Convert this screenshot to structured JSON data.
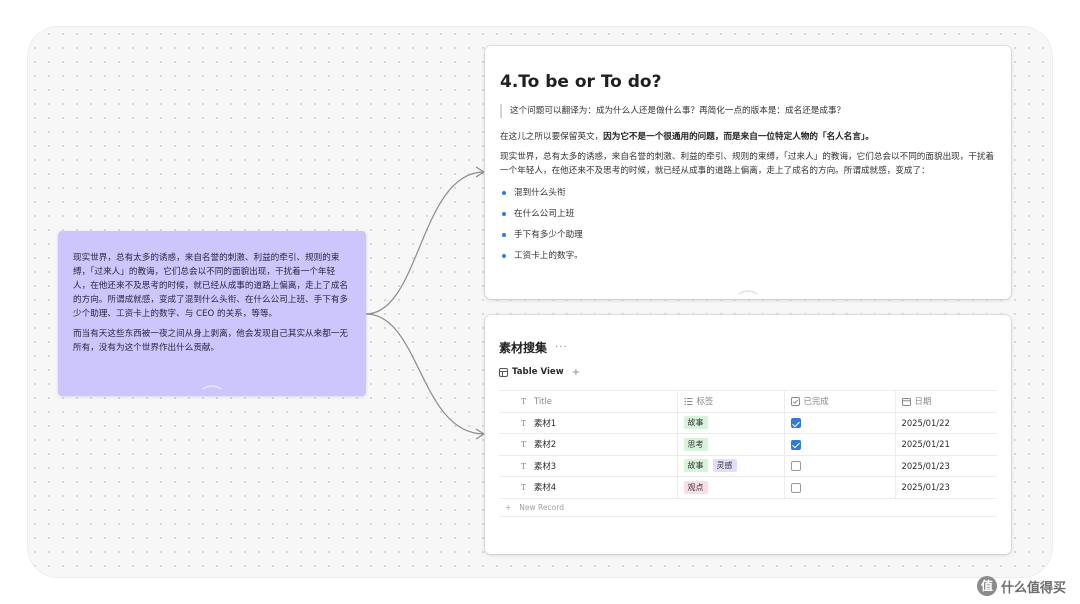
{
  "colors": {
    "card_purple": "#cdc6fd",
    "accent_blue": "#2f7bd8",
    "tag_green": "#d7f3dc",
    "tag_purple": "#e3ddfb",
    "tag_pink": "#fbdde7"
  },
  "note_card": {
    "paragraph_1": "现实世界，总有太多的诱惑，来自名誉的刺激、利益的牵引、规则的束缚，「过来人」的教诲，它们总会以不同的面貌出现，干扰着一个年轻人，在他还来不及思考的时候，就已经从成事的道路上偏离，走上了成名的方向。所谓成就感，变成了混到什么头衔、在什么公司上班、手下有多少个助理、工资卡上的数字、与 CEO 的关系，等等。",
    "paragraph_2": "而当有天这些东西被一夜之间从身上剥离，他会发现自己其实从来都一无所有，没有为这个世界作出什么贡献。"
  },
  "doc_card": {
    "title": "4.To be or To do?",
    "quote": "这个问题可以翻译为：成为什么人还是做什么事？再简化一点的版本是：成名还是成事？",
    "para_1_plain": "在这儿之所以要保留英文，",
    "para_1_bold": "因为它不是一个很通用的问题，而是来自一位特定人物的「名人名言」。",
    "para_2": "现实世界，总有太多的诱惑，来自名誉的刺激、利益的牵引、规则的束缚，「过来人」的教诲，它们总会以不同的面貌出现，干扰着一个年轻人，在他还来不及思考的时候，就已经从成事的道路上偏离，走上了成名的方向。所谓成就感，变成了：",
    "bullets": [
      "混到什么头衔",
      "在什么公司上班",
      "手下有多少个助理",
      "工资卡上的数字。"
    ]
  },
  "database": {
    "title": "素材搜集",
    "more": "···",
    "view_tab": "Table View",
    "add_view": "+",
    "columns": {
      "title": "Title",
      "tags": "标签",
      "done": "已完成",
      "date": "日期"
    },
    "rows": [
      {
        "title": "素材1",
        "tags": [
          {
            "label": "故事",
            "color": "green"
          }
        ],
        "done": true,
        "date": "2025/01/22"
      },
      {
        "title": "素材2",
        "tags": [
          {
            "label": "思考",
            "color": "green"
          }
        ],
        "done": true,
        "date": "2025/01/21"
      },
      {
        "title": "素材3",
        "tags": [
          {
            "label": "故事",
            "color": "green"
          },
          {
            "label": "灵感",
            "color": "purple"
          }
        ],
        "done": false,
        "date": "2025/01/23"
      },
      {
        "title": "素材4",
        "tags": [
          {
            "label": "观点",
            "color": "pink"
          }
        ],
        "done": false,
        "date": "2025/01/23"
      }
    ],
    "new_record_plus": "+",
    "new_record": "New Record"
  },
  "watermark": {
    "icon": "值",
    "text": "什么值得买"
  }
}
